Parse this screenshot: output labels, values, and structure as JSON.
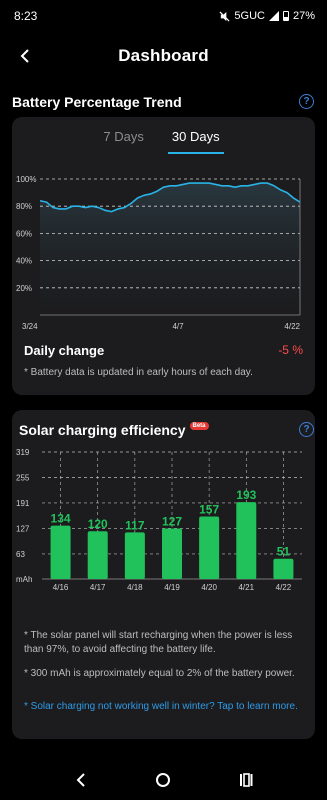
{
  "status": {
    "time": "8:23",
    "network": "5GUC",
    "battery": "27%"
  },
  "header": {
    "title": "Dashboard"
  },
  "battery_section": {
    "title": "Battery Percentage Trend",
    "help": "?",
    "tabs": [
      {
        "label": "7 Days",
        "active": false
      },
      {
        "label": "30 Days",
        "active": true
      }
    ],
    "daily_label": "Daily change",
    "daily_value": "-5 %",
    "note": "* Battery data is updated in early hours of each day."
  },
  "solar_section": {
    "title": "Solar charging efficiency",
    "badge": "Beta",
    "help": "?",
    "note1": "* The solar panel will start recharging when the power is less than 97%, to avoid affecting the battery life.",
    "note2": "* 300 mAh is approximately equal to 2% of the battery power.",
    "link": "* Solar charging not working well in winter? Tap to learn more."
  },
  "chart_data": [
    {
      "type": "line",
      "title": "",
      "ylabel": "",
      "y_ticks": [
        "100%",
        "80%",
        "60%",
        "40%",
        "20%"
      ],
      "y_tick_values": [
        100,
        80,
        60,
        40,
        20
      ],
      "ylim": [
        0,
        100
      ],
      "x_ticks": [
        "3/24",
        "4/7",
        "4/22"
      ],
      "color": "#2ab3e6",
      "series": [
        {
          "values": [
            84,
            83,
            79,
            78,
            78,
            80,
            80,
            79,
            80,
            79,
            77,
            76,
            78,
            79,
            82,
            86,
            88,
            89,
            91,
            94,
            95,
            95,
            96,
            97,
            97,
            97,
            97,
            96,
            95,
            95,
            94,
            95,
            95,
            96,
            97,
            97,
            95,
            92,
            90,
            86,
            83
          ]
        }
      ]
    },
    {
      "type": "bar",
      "title": "",
      "ylabel": "mAh",
      "y_ticks": [
        "319",
        "255",
        "191",
        "127",
        "63"
      ],
      "y_tick_values": [
        319,
        255,
        191,
        127,
        63
      ],
      "ylim": [
        0,
        319
      ],
      "categories": [
        "4/16",
        "4/17",
        "4/18",
        "4/19",
        "4/20",
        "4/21",
        "4/22"
      ],
      "values": [
        134,
        120,
        117,
        127,
        157,
        193,
        51
      ],
      "color": "#21c25b"
    }
  ]
}
